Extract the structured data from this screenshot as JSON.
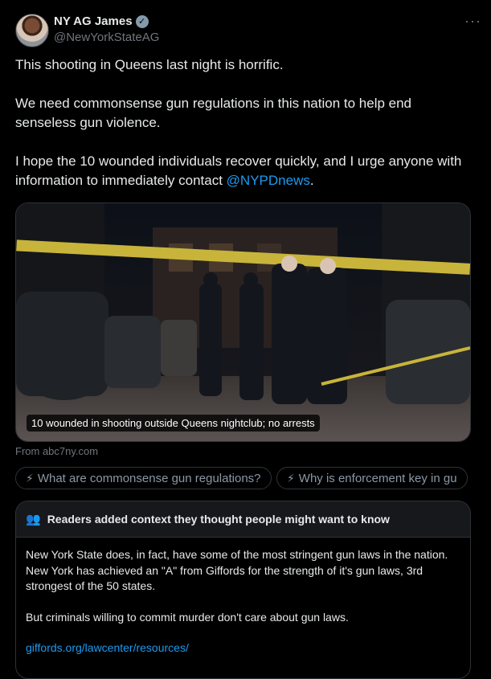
{
  "author": {
    "name": "NY AG James",
    "handle": "@NewYorkStateAG",
    "verified_icon": "check-badge-icon",
    "more_label": "···"
  },
  "tweet": {
    "line1": "This shooting in Queens last night is horrific.",
    "line2": "We need commonsense gun regulations in this nation to help end senseless gun violence.",
    "line3_prefix": "I hope the 10 wounded individuals recover quickly, and I urge anyone with information to immediately contact ",
    "mention": "@NYPDnews",
    "line3_suffix": "."
  },
  "media": {
    "caption": "10 wounded in shooting outside Queens nightclub; no arrests",
    "source": "From abc7ny.com"
  },
  "grok_chips": [
    {
      "icon": "grok-icon",
      "label": "What are commonsense gun regulations?"
    },
    {
      "icon": "grok-icon",
      "label": "Why is enforcement key in gu"
    }
  ],
  "community_note": {
    "icon": "people-icon",
    "title": "Readers added context they thought people might want to know",
    "para1": "New York State does, in fact, have some of the most stringent gun laws in the nation. New York has achieved an \"A\" from Giffords for the strength of it's gun laws, 3rd strongest of the 50 states.",
    "para2": "But criminals willing to commit murder don't care about gun laws.",
    "link": "giffords.org/lawcenter/resources/"
  },
  "colors": {
    "link": "#1d9bf0",
    "muted": "#71767b",
    "bg": "#000000"
  }
}
